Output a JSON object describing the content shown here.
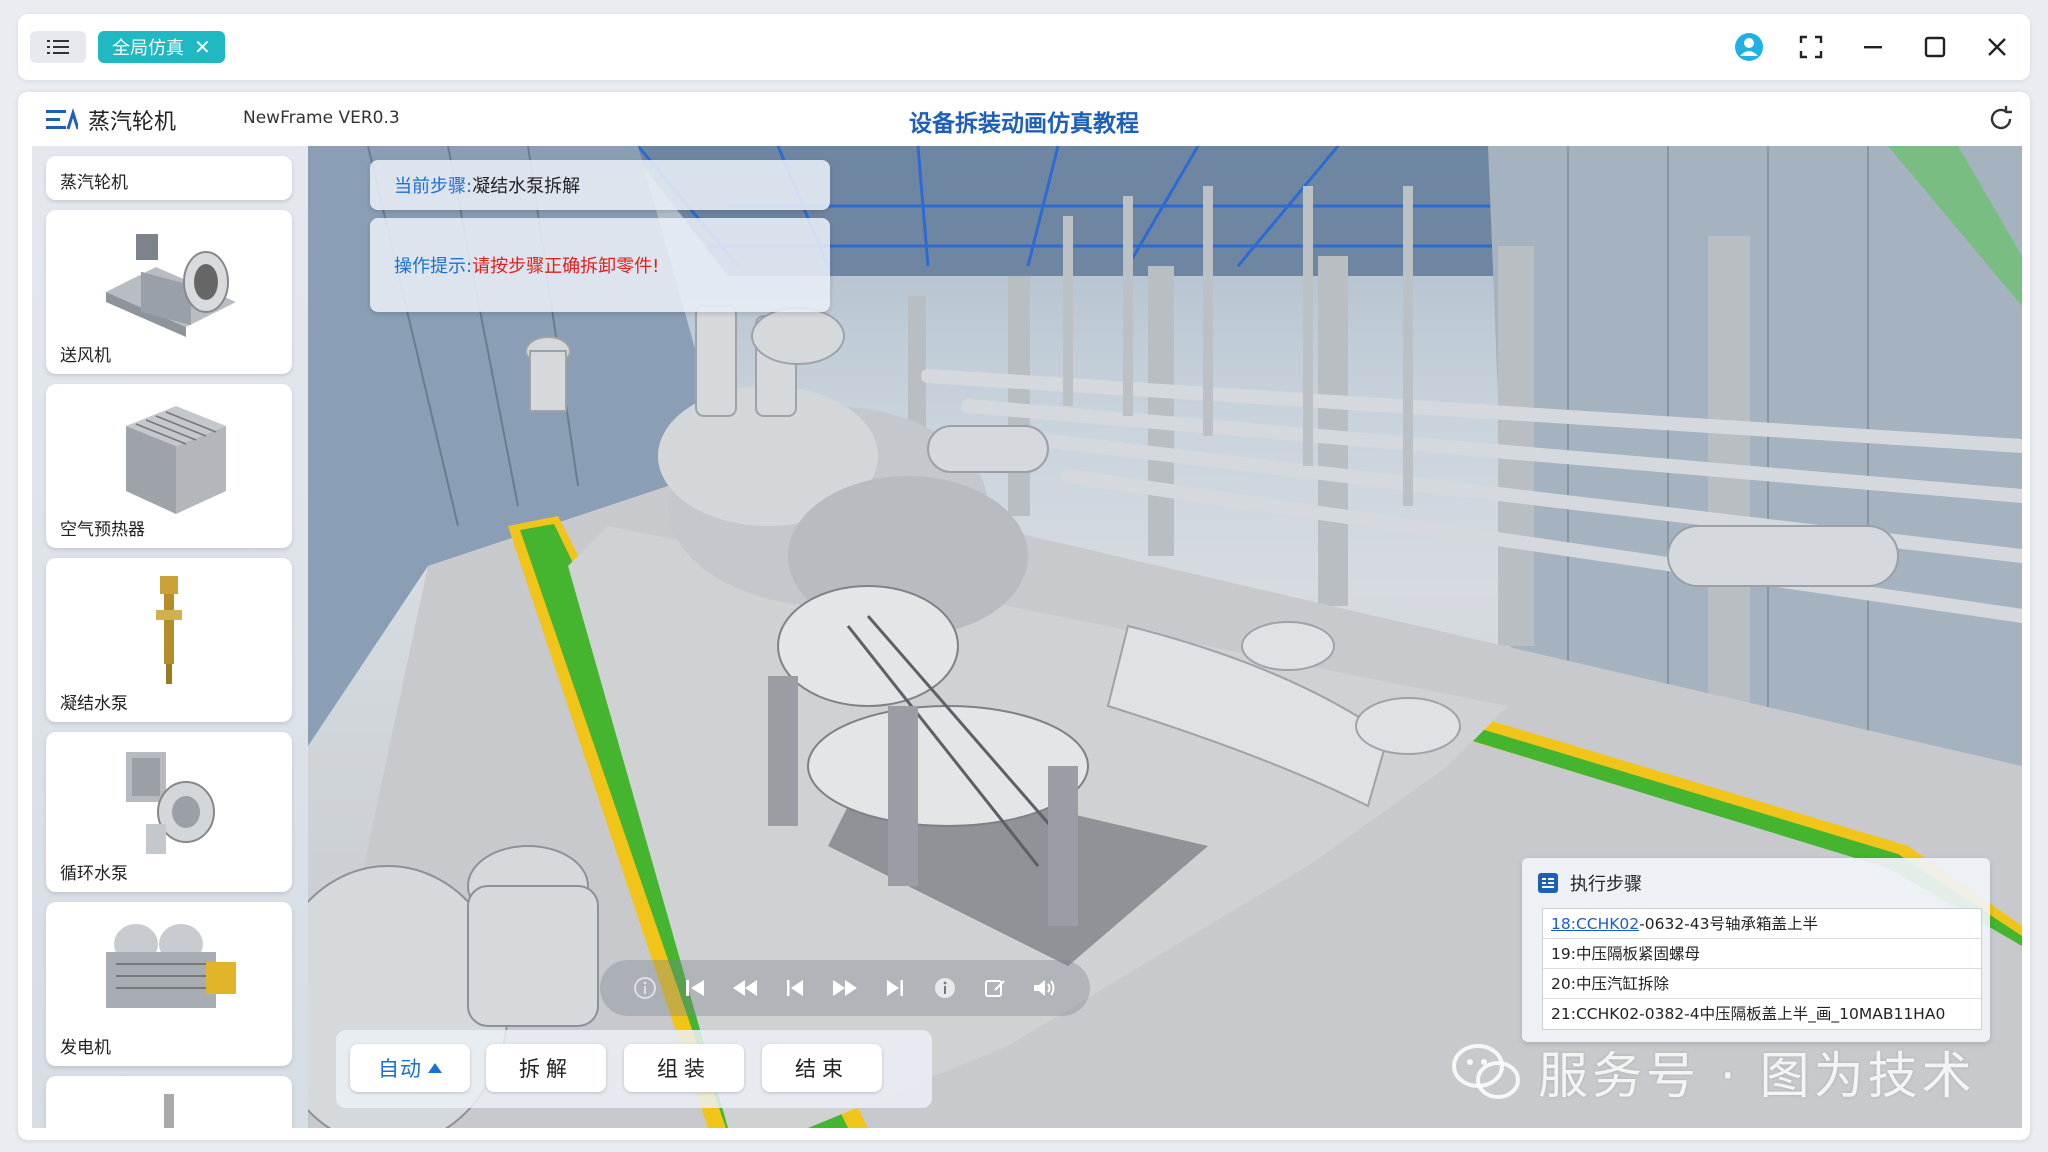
{
  "window": {
    "tab_label": "全局仿真"
  },
  "header": {
    "app_title": "蒸汽轮机",
    "version": "NewFrame VER0.3",
    "page_title": "设备拆装动画仿真教程"
  },
  "sidebar": {
    "items": [
      {
        "label": "蒸汽轮机"
      },
      {
        "label": "送风机"
      },
      {
        "label": "空气预热器"
      },
      {
        "label": "凝结水泵"
      },
      {
        "label": "循环水泵"
      },
      {
        "label": "发电机"
      }
    ]
  },
  "info": {
    "step_key": "当前步骤:",
    "step_value": "凝结水泵拆解",
    "hint_key": "操作提示:",
    "hint_value": "请按步骤正确拆卸零件!"
  },
  "steps": {
    "title": "执行步骤",
    "rows": [
      {
        "link": "18:CCHK02",
        "rest": "-0632-43号轴承箱盖上半"
      },
      {
        "link": "",
        "rest": "19:中压隔板紧固螺母"
      },
      {
        "link": "",
        "rest": "20:中压汽缸拆除"
      },
      {
        "link": "",
        "rest": "21:CCHK02-0382-4中压隔板盖上半_画_10MAB11HA0"
      }
    ]
  },
  "actions": {
    "auto": "自动",
    "disassemble": "拆解",
    "assemble": "组装",
    "finish": "结束"
  },
  "watermark": {
    "text": "服务号 · 图为技术"
  },
  "colors": {
    "accent": "#1d6fd0",
    "tab_teal": "#1fb8c3",
    "title_blue": "#1e5fb8",
    "warn_red": "#e0201c",
    "floor_green": "#45b42e",
    "floor_yellow": "#f0c419"
  }
}
